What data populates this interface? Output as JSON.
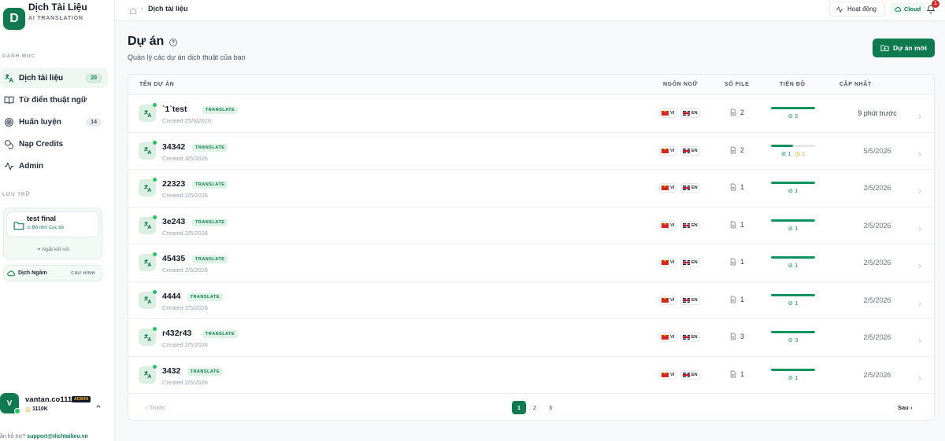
{
  "brand": {
    "logo_letter": "D",
    "name": "Dịch Tài Liệu",
    "subtitle": "AI TRANSLATION"
  },
  "sidebar": {
    "section_category": "DANH MỤC",
    "items": [
      {
        "label": "Dịch tài liệu",
        "icon": "translate-icon",
        "badge": "20",
        "active": true
      },
      {
        "label": "Từ điển thuật ngữ",
        "icon": "book-icon",
        "badge": ""
      },
      {
        "label": "Huấn luyện",
        "icon": "target-icon",
        "badge": "14"
      },
      {
        "label": "Nạp Credits",
        "icon": "coins-icon",
        "badge": ""
      },
      {
        "label": "Admin",
        "icon": "activity-icon",
        "badge": ""
      }
    ],
    "section_storage": "LƯU TRỮ",
    "storage": {
      "title": "test final",
      "subtitle": "⊙ Bộ nhớ Cục bộ",
      "disconnect": "Ngắt kết nối"
    },
    "offline": {
      "label": "Dịch Ngầm",
      "config": "CẤU HÌNH"
    },
    "user": {
      "initial": "V",
      "name": "vantan.co111",
      "role": "ADMIN",
      "credits": "1110K"
    },
    "support": {
      "prefix": "ần hỗ trợ? ",
      "email": "support@dichtailieu.vn"
    }
  },
  "topbar": {
    "breadcrumb": "Dịch tài liệu",
    "activity_label": "Hoạt động",
    "cloud_label": "Cloud",
    "notifications": "1"
  },
  "page": {
    "title": "Dự án",
    "subtitle": "Quản lý các dự án dịch thuật của bạn",
    "new_button": "Dự án mới"
  },
  "table": {
    "headers": {
      "name": "TÊN DỰ ÁN",
      "lang": "NGÔN NGỮ",
      "files": "SỐ FILE",
      "progress": "TIẾN ĐỘ",
      "updated": "CẬP NHẬT"
    },
    "rows": [
      {
        "name": "`1`test",
        "tag": "TRANSLATE",
        "created": "Created 25/5/2026",
        "src": "VI",
        "tgt": "EN",
        "files": "2",
        "done": "2",
        "pending": "",
        "progress": 1.0,
        "updated": "9 phút trước"
      },
      {
        "name": "34342",
        "tag": "TRANSLATE",
        "created": "Created 3/5/2026",
        "src": "VI",
        "tgt": "EN",
        "files": "2",
        "done": "1",
        "pending": "1",
        "progress": 0.5,
        "updated": "5/5/2026"
      },
      {
        "name": "22323",
        "tag": "TRANSLATE",
        "created": "Created 2/5/2026",
        "src": "VI",
        "tgt": "EN",
        "files": "1",
        "done": "1",
        "pending": "",
        "progress": 1.0,
        "updated": "2/5/2026"
      },
      {
        "name": "3e243",
        "tag": "TRANSLATE",
        "created": "Created 2/5/2026",
        "src": "VI",
        "tgt": "EN",
        "files": "1",
        "done": "1",
        "pending": "",
        "progress": 1.0,
        "updated": "2/5/2026"
      },
      {
        "name": "45435",
        "tag": "TRANSLATE",
        "created": "Created 2/5/2026",
        "src": "VI",
        "tgt": "EN",
        "files": "1",
        "done": "1",
        "pending": "",
        "progress": 1.0,
        "updated": "2/5/2026"
      },
      {
        "name": "4444",
        "tag": "TRANSLATE",
        "created": "Created 2/5/2026",
        "src": "VI",
        "tgt": "EN",
        "files": "1",
        "done": "1",
        "pending": "",
        "progress": 1.0,
        "updated": "2/5/2026"
      },
      {
        "name": "r432r43",
        "tag": "TRANSLATE",
        "created": "Created 2/5/2026",
        "src": "VI",
        "tgt": "EN",
        "files": "3",
        "done": "3",
        "pending": "",
        "progress": 1.0,
        "updated": "2/5/2026"
      },
      {
        "name": "3432",
        "tag": "TRANSLATE",
        "created": "Created 2/5/2026",
        "src": "VI",
        "tgt": "EN",
        "files": "1",
        "done": "1",
        "pending": "",
        "progress": 1.0,
        "updated": "2/5/2026"
      }
    ]
  },
  "pagination": {
    "prev": "Trước",
    "next": "Sau",
    "pages": [
      "1",
      "2",
      "3"
    ],
    "current": "1"
  },
  "colors": {
    "accent": "#0f7a50",
    "success": "#10935e",
    "warning": "#f59e0b",
    "danger": "#dc2626"
  }
}
